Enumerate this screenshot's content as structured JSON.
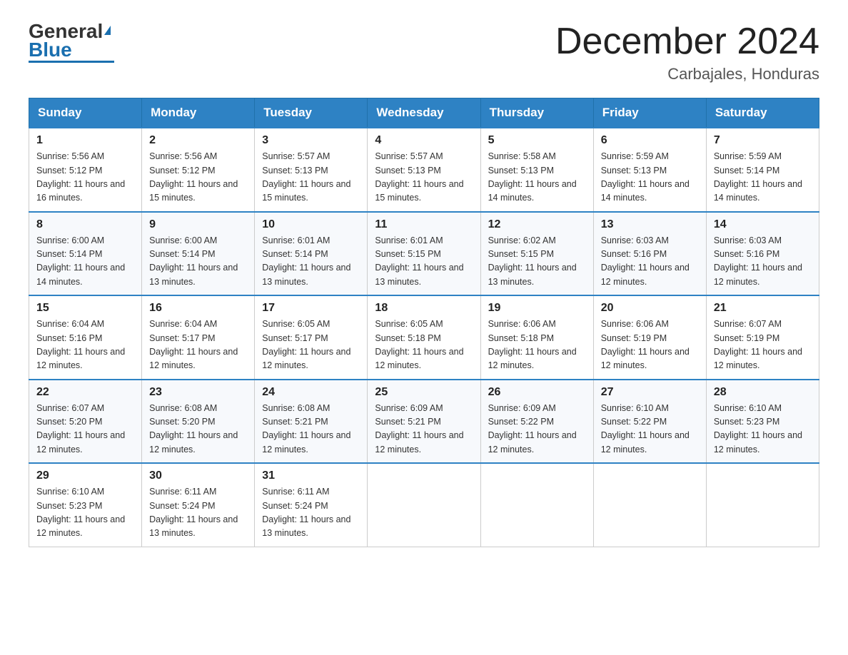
{
  "header": {
    "logo_general": "General",
    "logo_blue": "Blue",
    "month_title": "December 2024",
    "location": "Carbajales, Honduras"
  },
  "days_of_week": [
    "Sunday",
    "Monday",
    "Tuesday",
    "Wednesday",
    "Thursday",
    "Friday",
    "Saturday"
  ],
  "weeks": [
    [
      {
        "day": "1",
        "sunrise": "Sunrise: 5:56 AM",
        "sunset": "Sunset: 5:12 PM",
        "daylight": "Daylight: 11 hours and 16 minutes."
      },
      {
        "day": "2",
        "sunrise": "Sunrise: 5:56 AM",
        "sunset": "Sunset: 5:12 PM",
        "daylight": "Daylight: 11 hours and 15 minutes."
      },
      {
        "day": "3",
        "sunrise": "Sunrise: 5:57 AM",
        "sunset": "Sunset: 5:13 PM",
        "daylight": "Daylight: 11 hours and 15 minutes."
      },
      {
        "day": "4",
        "sunrise": "Sunrise: 5:57 AM",
        "sunset": "Sunset: 5:13 PM",
        "daylight": "Daylight: 11 hours and 15 minutes."
      },
      {
        "day": "5",
        "sunrise": "Sunrise: 5:58 AM",
        "sunset": "Sunset: 5:13 PM",
        "daylight": "Daylight: 11 hours and 14 minutes."
      },
      {
        "day": "6",
        "sunrise": "Sunrise: 5:59 AM",
        "sunset": "Sunset: 5:13 PM",
        "daylight": "Daylight: 11 hours and 14 minutes."
      },
      {
        "day": "7",
        "sunrise": "Sunrise: 5:59 AM",
        "sunset": "Sunset: 5:14 PM",
        "daylight": "Daylight: 11 hours and 14 minutes."
      }
    ],
    [
      {
        "day": "8",
        "sunrise": "Sunrise: 6:00 AM",
        "sunset": "Sunset: 5:14 PM",
        "daylight": "Daylight: 11 hours and 14 minutes."
      },
      {
        "day": "9",
        "sunrise": "Sunrise: 6:00 AM",
        "sunset": "Sunset: 5:14 PM",
        "daylight": "Daylight: 11 hours and 13 minutes."
      },
      {
        "day": "10",
        "sunrise": "Sunrise: 6:01 AM",
        "sunset": "Sunset: 5:14 PM",
        "daylight": "Daylight: 11 hours and 13 minutes."
      },
      {
        "day": "11",
        "sunrise": "Sunrise: 6:01 AM",
        "sunset": "Sunset: 5:15 PM",
        "daylight": "Daylight: 11 hours and 13 minutes."
      },
      {
        "day": "12",
        "sunrise": "Sunrise: 6:02 AM",
        "sunset": "Sunset: 5:15 PM",
        "daylight": "Daylight: 11 hours and 13 minutes."
      },
      {
        "day": "13",
        "sunrise": "Sunrise: 6:03 AM",
        "sunset": "Sunset: 5:16 PM",
        "daylight": "Daylight: 11 hours and 12 minutes."
      },
      {
        "day": "14",
        "sunrise": "Sunrise: 6:03 AM",
        "sunset": "Sunset: 5:16 PM",
        "daylight": "Daylight: 11 hours and 12 minutes."
      }
    ],
    [
      {
        "day": "15",
        "sunrise": "Sunrise: 6:04 AM",
        "sunset": "Sunset: 5:16 PM",
        "daylight": "Daylight: 11 hours and 12 minutes."
      },
      {
        "day": "16",
        "sunrise": "Sunrise: 6:04 AM",
        "sunset": "Sunset: 5:17 PM",
        "daylight": "Daylight: 11 hours and 12 minutes."
      },
      {
        "day": "17",
        "sunrise": "Sunrise: 6:05 AM",
        "sunset": "Sunset: 5:17 PM",
        "daylight": "Daylight: 11 hours and 12 minutes."
      },
      {
        "day": "18",
        "sunrise": "Sunrise: 6:05 AM",
        "sunset": "Sunset: 5:18 PM",
        "daylight": "Daylight: 11 hours and 12 minutes."
      },
      {
        "day": "19",
        "sunrise": "Sunrise: 6:06 AM",
        "sunset": "Sunset: 5:18 PM",
        "daylight": "Daylight: 11 hours and 12 minutes."
      },
      {
        "day": "20",
        "sunrise": "Sunrise: 6:06 AM",
        "sunset": "Sunset: 5:19 PM",
        "daylight": "Daylight: 11 hours and 12 minutes."
      },
      {
        "day": "21",
        "sunrise": "Sunrise: 6:07 AM",
        "sunset": "Sunset: 5:19 PM",
        "daylight": "Daylight: 11 hours and 12 minutes."
      }
    ],
    [
      {
        "day": "22",
        "sunrise": "Sunrise: 6:07 AM",
        "sunset": "Sunset: 5:20 PM",
        "daylight": "Daylight: 11 hours and 12 minutes."
      },
      {
        "day": "23",
        "sunrise": "Sunrise: 6:08 AM",
        "sunset": "Sunset: 5:20 PM",
        "daylight": "Daylight: 11 hours and 12 minutes."
      },
      {
        "day": "24",
        "sunrise": "Sunrise: 6:08 AM",
        "sunset": "Sunset: 5:21 PM",
        "daylight": "Daylight: 11 hours and 12 minutes."
      },
      {
        "day": "25",
        "sunrise": "Sunrise: 6:09 AM",
        "sunset": "Sunset: 5:21 PM",
        "daylight": "Daylight: 11 hours and 12 minutes."
      },
      {
        "day": "26",
        "sunrise": "Sunrise: 6:09 AM",
        "sunset": "Sunset: 5:22 PM",
        "daylight": "Daylight: 11 hours and 12 minutes."
      },
      {
        "day": "27",
        "sunrise": "Sunrise: 6:10 AM",
        "sunset": "Sunset: 5:22 PM",
        "daylight": "Daylight: 11 hours and 12 minutes."
      },
      {
        "day": "28",
        "sunrise": "Sunrise: 6:10 AM",
        "sunset": "Sunset: 5:23 PM",
        "daylight": "Daylight: 11 hours and 12 minutes."
      }
    ],
    [
      {
        "day": "29",
        "sunrise": "Sunrise: 6:10 AM",
        "sunset": "Sunset: 5:23 PM",
        "daylight": "Daylight: 11 hours and 12 minutes."
      },
      {
        "day": "30",
        "sunrise": "Sunrise: 6:11 AM",
        "sunset": "Sunset: 5:24 PM",
        "daylight": "Daylight: 11 hours and 13 minutes."
      },
      {
        "day": "31",
        "sunrise": "Sunrise: 6:11 AM",
        "sunset": "Sunset: 5:24 PM",
        "daylight": "Daylight: 11 hours and 13 minutes."
      },
      null,
      null,
      null,
      null
    ]
  ]
}
